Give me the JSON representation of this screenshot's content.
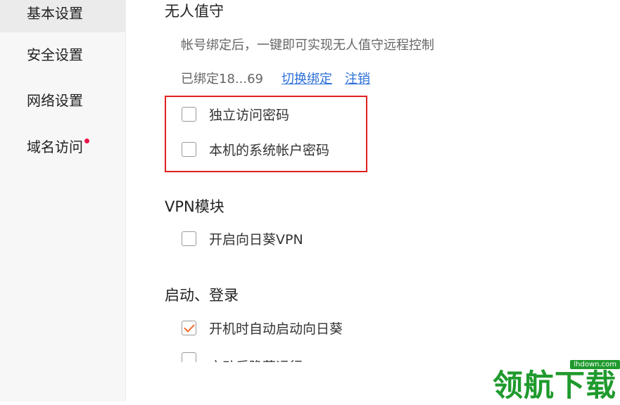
{
  "sidebar": {
    "items": [
      {
        "label": "基本设置"
      },
      {
        "label": "安全设置"
      },
      {
        "label": "网络设置"
      },
      {
        "label": "域名访问"
      }
    ]
  },
  "unattended": {
    "title": "无人值守",
    "description": "帐号绑定后，一键即可实现无人值守远程控制",
    "bound_text": "已绑定18...69",
    "switch_link": "切换绑定",
    "logout_link": "注销",
    "options": [
      {
        "label": "独立访问密码",
        "checked": false
      },
      {
        "label": "本机的系统帐户密码",
        "checked": false
      }
    ]
  },
  "vpn": {
    "title": "VPN模块",
    "options": [
      {
        "label": "开启向日葵VPN",
        "checked": false
      }
    ]
  },
  "startup": {
    "title": "启动、登录",
    "options": [
      {
        "label": "开机时自动启动向日葵",
        "checked": true
      }
    ],
    "cut_label": "启动后隐藏运行"
  },
  "watermark": {
    "text": "领航下载",
    "site": "lhdown.com"
  },
  "colors": {
    "highlight_border": "#e02020",
    "link": "#2b6fd8",
    "check": "#f06a2a",
    "dot": "#e8194a",
    "watermark_green": "#1f9a2d"
  }
}
